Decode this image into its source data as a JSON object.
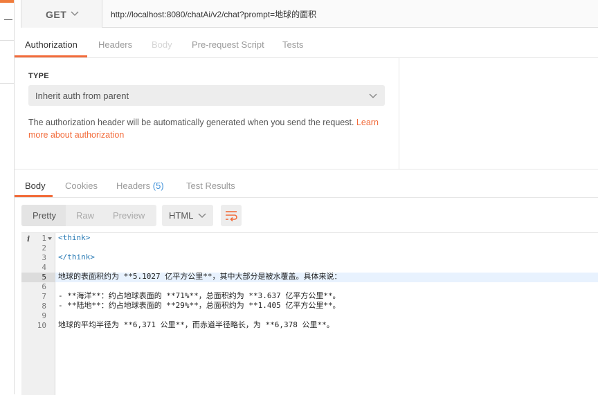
{
  "request": {
    "method": "GET",
    "url": "http://localhost:8080/chatAi/v2/chat?prompt=地球的面积"
  },
  "request_tabs": [
    "Authorization",
    "Headers",
    "Body",
    "Pre-request Script",
    "Tests"
  ],
  "auth": {
    "type_label": "TYPE",
    "type_value": "Inherit auth from parent",
    "description": "The authorization header will be automatically generated when you send the request.",
    "link_text": "Learn more about authorization"
  },
  "response_tabs": {
    "body": "Body",
    "cookies": "Cookies",
    "headers": "Headers",
    "headers_count": "(5)",
    "test_results": "Test Results"
  },
  "view_modes": [
    "Pretty",
    "Raw",
    "Preview"
  ],
  "format": "HTML",
  "editor": {
    "line_numbers": [
      "1",
      "2",
      "3",
      "4",
      "5",
      "6",
      "7",
      "8",
      "9",
      "10"
    ],
    "current_line": 5,
    "lines": [
      "<think>",
      "",
      "</think>",
      "",
      "地球的表面积约为 **5.1027 亿平方公里**，其中大部分是被水覆盖。具体来说：",
      "",
      "- **海洋**：约占地球表面的 **71%**，总面积约为 **3.637 亿平方公里**。",
      "- **陆地**：约占地球表面的 **29%**，总面积约为 **1.405 亿平方公里**。",
      "",
      "地球的平均半径为 **6,371 公里**，而赤道半径略长，为 **6,378 公里**。"
    ]
  },
  "colors": {
    "accent": "#f26b3a",
    "count_blue": "#3c8fd8"
  }
}
